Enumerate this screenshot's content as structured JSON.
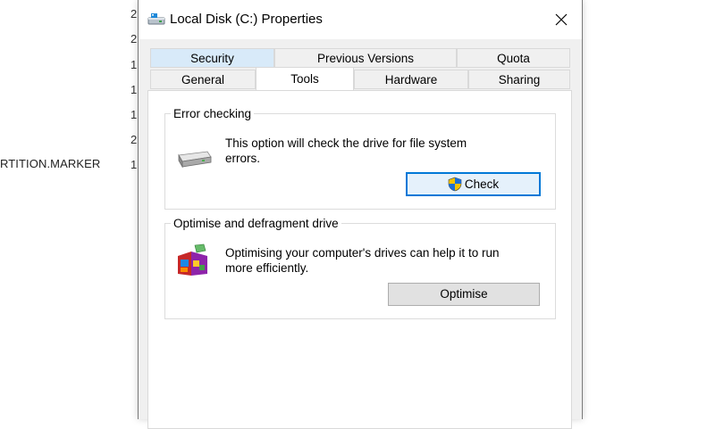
{
  "background": {
    "digits": [
      "2",
      "2",
      "1",
      "1",
      "1",
      "2",
      "1"
    ],
    "marker_text": "RTITION.MARKER"
  },
  "window": {
    "title": "Local Disk (C:) Properties",
    "icon": "drive-icon",
    "close_icon": "close-icon"
  },
  "tabs": {
    "row_top": [
      {
        "label": "Security"
      },
      {
        "label": "Previous Versions"
      },
      {
        "label": "Quota"
      }
    ],
    "row_bottom": [
      {
        "label": "General"
      },
      {
        "label": "Tools"
      },
      {
        "label": "Hardware"
      },
      {
        "label": "Sharing"
      }
    ],
    "active": "Tools"
  },
  "error_checking": {
    "title": "Error checking",
    "description_line1": "This option will check the drive for file system",
    "description_line2": "errors.",
    "button_label": "Check",
    "button_icon": "uac-shield-icon",
    "icon": "hard-drive-icon"
  },
  "optimise": {
    "title": "Optimise and defragment drive",
    "description_line1": "Optimising your computer's drives can help it to run",
    "description_line2": "more efficiently.",
    "button_label": "Optimise",
    "icon": "defrag-icon"
  },
  "colors": {
    "focus_border": "#0078d7",
    "tab_highlight": "#d8eaf9",
    "window_bg": "#f0f0f0"
  }
}
